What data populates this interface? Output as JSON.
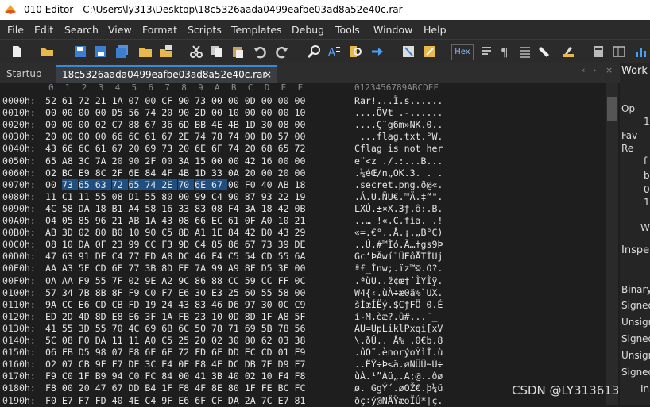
{
  "window": {
    "title": "010 Editor - C:\\Users\\ly313\\Desktop\\18c5326aada0499eafbe03ad8a52e40c.rar"
  },
  "menu": [
    "File",
    "Edit",
    "Search",
    "View",
    "Format",
    "Scripts",
    "Templates",
    "Debug",
    "Tools",
    "Window",
    "Help"
  ],
  "toolbar": {
    "hex_label": "Hex"
  },
  "tabs": {
    "startup": "Startup",
    "file": "18c5326aada0499eafbe03ad8a52e40c.rar",
    "close": "×",
    "right": "Work"
  },
  "hex": {
    "columns": [
      "0",
      "1",
      "2",
      "3",
      "4",
      "5",
      "6",
      "7",
      "8",
      "9",
      "A",
      "B",
      "C",
      "D",
      "E",
      "F"
    ],
    "ascii_header": "0123456789ABCDEF",
    "rows": [
      {
        "addr": "0000h:",
        "bytes": [
          "52",
          "61",
          "72",
          "21",
          "1A",
          "07",
          "00",
          "CF",
          "90",
          "73",
          "00",
          "00",
          "0D",
          "00",
          "00",
          "00"
        ],
        "ascii": "Rar!...Ï.s......"
      },
      {
        "addr": "0010h:",
        "bytes": [
          "00",
          "00",
          "00",
          "00",
          "D5",
          "56",
          "74",
          "20",
          "90",
          "2D",
          "00",
          "10",
          "00",
          "00",
          "00",
          "10"
        ],
        "ascii": "....ÕVt .-......"
      },
      {
        "addr": "0020h:",
        "bytes": [
          "00",
          "00",
          "00",
          "02",
          "C7",
          "88",
          "67",
          "36",
          "6D",
          "BB",
          "4E",
          "4B",
          "1D",
          "30",
          "08",
          "00"
        ],
        "ascii": "....Ç˜g6m»NK.0.."
      },
      {
        "addr": "0030h:",
        "bytes": [
          "20",
          "00",
          "00",
          "00",
          "66",
          "6C",
          "61",
          "67",
          "2E",
          "74",
          "78",
          "74",
          "00",
          "B0",
          "57",
          "00"
        ],
        "ascii": " ...flag.txt.°W."
      },
      {
        "addr": "0040h:",
        "bytes": [
          "43",
          "66",
          "6C",
          "61",
          "67",
          "20",
          "69",
          "73",
          "20",
          "6E",
          "6F",
          "74",
          "20",
          "68",
          "65",
          "72"
        ],
        "ascii": "Cflag is not her"
      },
      {
        "addr": "0050h:",
        "bytes": [
          "65",
          "A8",
          "3C",
          "7A",
          "20",
          "90",
          "2F",
          "00",
          "3A",
          "15",
          "00",
          "00",
          "42",
          "16",
          "00",
          "00"
        ],
        "ascii": "e¨<z ./.:...B..."
      },
      {
        "addr": "0060h:",
        "bytes": [
          "02",
          "BC",
          "E9",
          "8C",
          "2F",
          "6E",
          "84",
          "4F",
          "4B",
          "1D",
          "33",
          "0A",
          "20",
          "00",
          "20",
          "00"
        ],
        "ascii": ".¼éŒ/n„OK.3. . ."
      },
      {
        "addr": "0070h:",
        "bytes": [
          "00",
          "73",
          "65",
          "63",
          "72",
          "65",
          "74",
          "2E",
          "70",
          "6E",
          "67",
          "00",
          "F0",
          "40",
          "AB",
          "18"
        ],
        "ascii": ".secret.png.ð@«."
      },
      {
        "addr": "0080h:",
        "bytes": [
          "11",
          "C1",
          "11",
          "55",
          "08",
          "D1",
          "55",
          "80",
          "00",
          "99",
          "C4",
          "90",
          "87",
          "93",
          "22",
          "19"
        ],
        "ascii": ".Á.U.ÑU€.™Ä.‡“\"."
      },
      {
        "addr": "0090h:",
        "bytes": [
          "4C",
          "58",
          "DA",
          "18",
          "B1",
          "A4",
          "58",
          "16",
          "33",
          "83",
          "08",
          "F4",
          "3A",
          "18",
          "42",
          "0B"
        ],
        "ascii": "LXÚ.±¤X.3ƒ.ô:.B."
      },
      {
        "addr": "00A0h:",
        "bytes": [
          "04",
          "05",
          "85",
          "96",
          "21",
          "AB",
          "1A",
          "43",
          "08",
          "66",
          "EC",
          "61",
          "0F",
          "A0",
          "10",
          "21"
        ],
        "ascii": "..…–!«.C.fìa. .!"
      },
      {
        "addr": "00B0h:",
        "bytes": [
          "AB",
          "3D",
          "02",
          "80",
          "B0",
          "10",
          "90",
          "C5",
          "8D",
          "A1",
          "1E",
          "84",
          "42",
          "B0",
          "43",
          "29"
        ],
        "ascii": "«=.€°..Å.¡.„B°C)"
      },
      {
        "addr": "00C0h:",
        "bytes": [
          "08",
          "10",
          "DA",
          "0F",
          "23",
          "99",
          "CC",
          "F3",
          "9D",
          "C4",
          "85",
          "86",
          "67",
          "73",
          "39",
          "DE"
        ],
        "ascii": "..Ú.#™Ìó.Ä…†gs9Þ"
      },
      {
        "addr": "00D0h:",
        "bytes": [
          "47",
          "63",
          "91",
          "DE",
          "C4",
          "77",
          "ED",
          "A8",
          "DC",
          "46",
          "F4",
          "C5",
          "54",
          "CD",
          "55",
          "6A"
        ],
        "ascii": "Gc‘ÞÄwí¨ÜFôÅTÍUj"
      },
      {
        "addr": "00E0h:",
        "bytes": [
          "AA",
          "A3",
          "5F",
          "CD",
          "6E",
          "77",
          "3B",
          "8D",
          "EF",
          "7A",
          "99",
          "A9",
          "8F",
          "D5",
          "3F",
          "00"
        ],
        "ascii": "ª£_Ínw;.ïz™©.Õ?."
      },
      {
        "addr": "00F0h:",
        "bytes": [
          "0A",
          "AA",
          "F9",
          "55",
          "7F",
          "02",
          "9E",
          "A2",
          "9C",
          "86",
          "88",
          "CC",
          "59",
          "CC",
          "FF",
          "0C"
        ],
        "ascii": ".ªùU..ž¢œ†ˆÌYÌÿ."
      },
      {
        "addr": "0100h:",
        "bytes": [
          "57",
          "34",
          "7B",
          "8B",
          "8F",
          "F9",
          "C0",
          "F7",
          "E6",
          "30",
          "E3",
          "25",
          "60",
          "55",
          "58",
          "00"
        ],
        "ascii": "W4{‹.ùÀ÷æ0ã%`UX."
      },
      {
        "addr": "0110h:",
        "bytes": [
          "9A",
          "CC",
          "E6",
          "CD",
          "CB",
          "FD",
          "19",
          "24",
          "43",
          "83",
          "46",
          "D6",
          "97",
          "30",
          "0C",
          "C9"
        ],
        "ascii": "šÌæÍËý.$CƒFÖ—0.É"
      },
      {
        "addr": "0120h:",
        "bytes": [
          "ED",
          "2D",
          "4D",
          "8D",
          "E8",
          "E6",
          "3F",
          "1A",
          "FB",
          "23",
          "10",
          "0D",
          "8D",
          "1F",
          "A8",
          "5F"
        ],
        "ascii": "í-M.èæ?.û#...¨_"
      },
      {
        "addr": "0130h:",
        "bytes": [
          "41",
          "55",
          "3D",
          "55",
          "70",
          "4C",
          "69",
          "6B",
          "6C",
          "50",
          "78",
          "71",
          "69",
          "5B",
          "78",
          "56"
        ],
        "ascii": "AU=UpLiklPxqi[xV"
      },
      {
        "addr": "0140h:",
        "bytes": [
          "5C",
          "08",
          "F0",
          "DA",
          "11",
          "11",
          "A0",
          "C5",
          "25",
          "20",
          "02",
          "30",
          "80",
          "62",
          "03",
          "38"
        ],
        "ascii": "\\.ðÚ.. Å% .0€b.8"
      },
      {
        "addr": "0150h:",
        "bytes": [
          "06",
          "FB",
          "D5",
          "98",
          "07",
          "E8",
          "6E",
          "6F",
          "72",
          "FD",
          "6F",
          "DD",
          "EC",
          "CD",
          "01",
          "F9"
        ],
        "ascii": ".ûÕ˜.ènorýoÝìÍ.ù"
      },
      {
        "addr": "0160h:",
        "bytes": [
          "02",
          "07",
          "CB",
          "9F",
          "F7",
          "DE",
          "3C",
          "E4",
          "0F",
          "F8",
          "4E",
          "DC",
          "DB",
          "7E",
          "D9",
          "F7"
        ],
        "ascii": "..ËŸ÷Þ<ä.øNÜÛ~Ù÷"
      },
      {
        "addr": "0170h:",
        "bytes": [
          "F9",
          "C0",
          "1F",
          "B9",
          "94",
          "C0",
          "FC",
          "84",
          "00",
          "41",
          "3B",
          "40",
          "02",
          "10",
          "F4",
          "F8"
        ],
        "ascii": "ùÀ.¹”Àü„.A;@..ôø"
      },
      {
        "addr": "0180h:",
        "bytes": [
          "F8",
          "00",
          "20",
          "47",
          "67",
          "DD",
          "B4",
          "1F",
          "F8",
          "4F",
          "8E",
          "80",
          "1F",
          "FE",
          "BC",
          "FC"
        ],
        "ascii": "ø. GgÝ´.øOŽ€.þ¼ü"
      },
      {
        "addr": "0190h:",
        "bytes": [
          "F0",
          "E7",
          "F7",
          "FD",
          "40",
          "4E",
          "C4",
          "9F",
          "E6",
          "6F",
          "CF",
          "DA",
          "2A",
          "7C",
          "E7",
          "81"
        ],
        "ascii": "ðç÷ý@NÄŸæoÏÚ*|ç."
      }
    ]
  },
  "right_panel": {
    "items": [
      "Op",
      "1",
      "Fav",
      "Re",
      "f",
      "b",
      "0",
      "1",
      "W",
      "Inspe",
      "Binary",
      "Signed",
      "Unsign",
      "Signed",
      "Unsign",
      "Signed",
      "In"
    ]
  },
  "watermark": "CSDN @LY313613",
  "colors": {
    "selection": "#1f4f80",
    "bg": "#1e1e1e",
    "tab_accent": "#3a88d8"
  }
}
